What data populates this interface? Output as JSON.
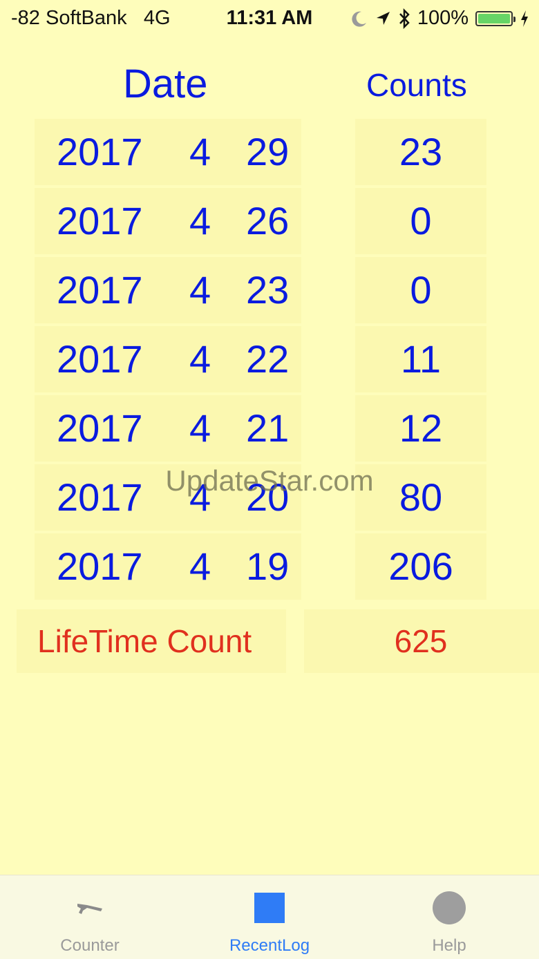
{
  "status_bar": {
    "carrier": "-82 SoftBank   4G",
    "time": "11:31 AM",
    "battery": "100%",
    "battery_level": 1.0,
    "icons": [
      "moon-icon",
      "location-arrow-icon",
      "bluetooth-icon",
      "battery-icon",
      "charging-bolt-icon"
    ]
  },
  "headers": {
    "date": "Date",
    "counts": "Counts"
  },
  "rows": [
    {
      "year": "2017",
      "month": "4",
      "day": "29",
      "count": "23"
    },
    {
      "year": "2017",
      "month": "4",
      "day": "26",
      "count": "0"
    },
    {
      "year": "2017",
      "month": "4",
      "day": "23",
      "count": "0"
    },
    {
      "year": "2017",
      "month": "4",
      "day": "22",
      "count": "11"
    },
    {
      "year": "2017",
      "month": "4",
      "day": "21",
      "count": "12"
    },
    {
      "year": "2017",
      "month": "4",
      "day": "20",
      "count": "80"
    },
    {
      "year": "2017",
      "month": "4",
      "day": "19",
      "count": "206"
    }
  ],
  "lifetime": {
    "label": "LifeTime Count",
    "value": "625"
  },
  "watermark": "UpdateStar.com",
  "tabs": [
    {
      "label": "Counter",
      "icon": "counter-icon",
      "active": false
    },
    {
      "label": "RecentLog",
      "icon": "square-icon",
      "active": true
    },
    {
      "label": "Help",
      "icon": "circle-icon",
      "active": false
    }
  ],
  "colors": {
    "background": "#fefdbb",
    "cell": "#fbf8b0",
    "text_blue": "#0a1bdf",
    "text_red": "#e0301e",
    "tab_active": "#2f7cf6",
    "tab_inactive": "#9a9a9a",
    "battery_fill": "#67d466"
  }
}
